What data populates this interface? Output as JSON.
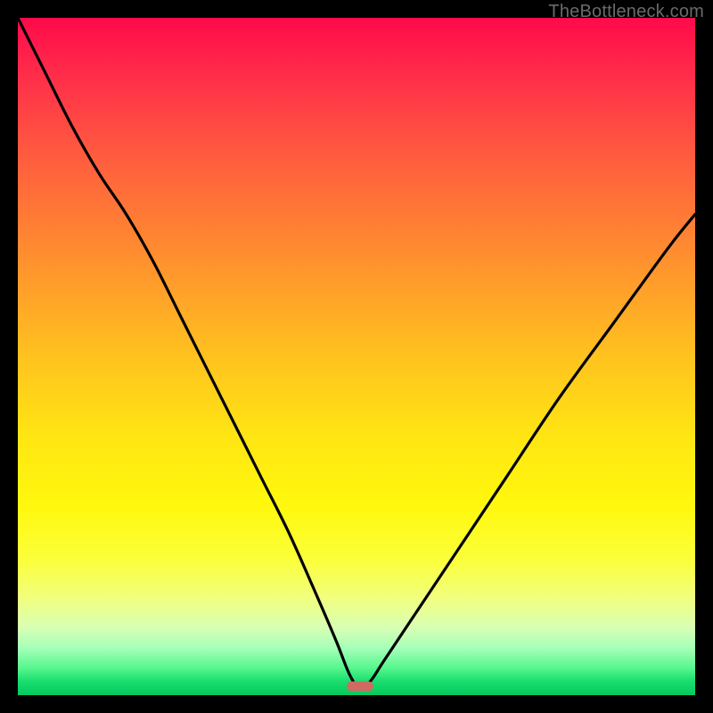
{
  "watermark": "TheBottleneck.com",
  "marker": {
    "x_pct": 50.5,
    "y_pct": 98.7,
    "color": "#cf6b63"
  },
  "chart_data": {
    "type": "line",
    "title": "",
    "xlabel": "",
    "ylabel": "",
    "xlim": [
      0,
      100
    ],
    "ylim": [
      0,
      100
    ],
    "grid": false,
    "legend": false,
    "series": [
      {
        "name": "bottleneck-curve",
        "x": [
          0,
          4,
          8,
          12,
          16,
          20,
          24,
          28,
          32,
          36,
          40,
          44,
          47,
          49,
          50.5,
          52,
          54,
          58,
          64,
          72,
          80,
          88,
          96,
          100
        ],
        "y": [
          100,
          92,
          84,
          77,
          71,
          64,
          56,
          48,
          40,
          32,
          24,
          15,
          8,
          3,
          1,
          2,
          5,
          11,
          20,
          32,
          44,
          55,
          66,
          71
        ]
      }
    ],
    "annotations": [
      {
        "type": "pill",
        "x": 50.5,
        "y": 1.3,
        "color": "#cf6b63"
      }
    ]
  }
}
